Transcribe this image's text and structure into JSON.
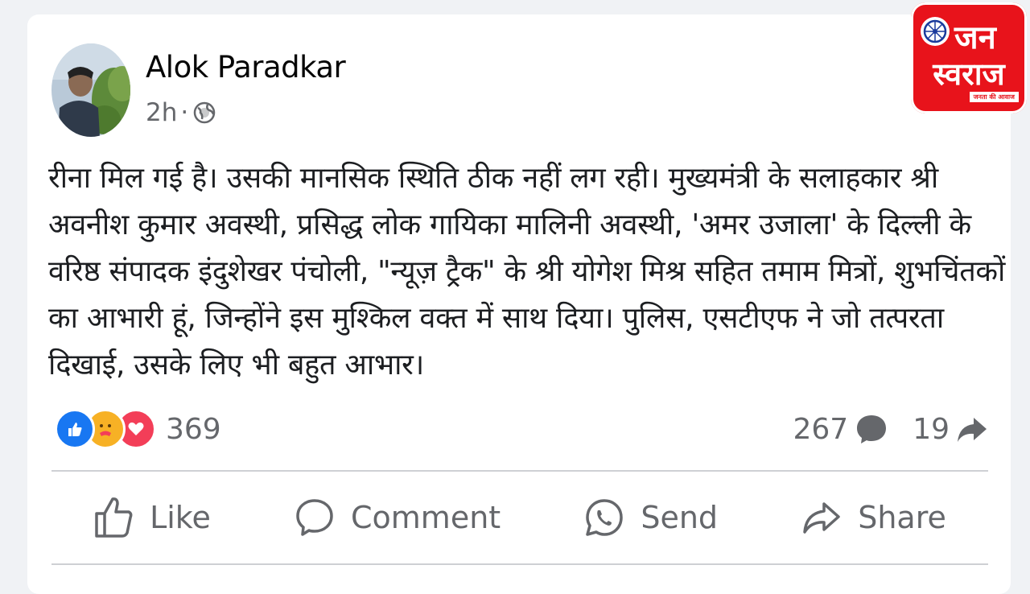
{
  "post": {
    "author": "Alok Paradkar",
    "time": "2h",
    "separator": "·",
    "text": "रीना मिल गई है। उसकी मानसिक स्थिति ठीक नहीं लग रही। मुख्यमंत्री के सलाहकार श्री अवनीश कुमार अवस्थी, प्रसिद्ध लोक गायिका मालिनी अवस्थी, 'अमर उजाला' के दिल्ली के वरिष्ठ संपादक इंदुशेखर पंचोली, \"न्यूज़ ट्रैक\" के श्री योगेश मिश्र सहित तमाम मित्रों, शुभचिंतकों का आभारी हूं, जिन्होंने इस मुश्किल वक्त में साथ दिया। पुलिस, एसटीएफ ने जो तत्परता दिखाई, उसके लिए भी बहुत आभार।"
  },
  "engagement": {
    "reactions_count": "369",
    "comments_count": "267",
    "shares_count": "19",
    "reaction_icons": [
      "like-icon",
      "care-icon",
      "love-icon"
    ]
  },
  "actions": {
    "like_label": "Like",
    "comment_label": "Comment",
    "send_label": "Send",
    "share_label": "Share"
  },
  "logo": {
    "line1": "जन",
    "line2": "स्वराज",
    "tagline": "जनता की आवाज",
    "color": "#e8131b"
  },
  "colors": {
    "like_blue": "#1877f2",
    "love_red": "#f33e58",
    "care_yellow": "#f7b125",
    "secondary_text": "#65676b"
  }
}
